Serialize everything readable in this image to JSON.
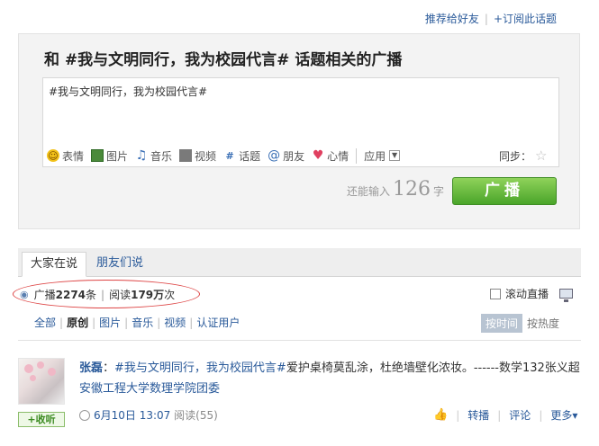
{
  "header": {
    "recommend_label": "推荐给好友",
    "subscribe_label": "+订阅此话题"
  },
  "composer": {
    "title": "和 #我与文明同行，我为校园代言# 话题相关的广播",
    "text": "#我与文明同行，我为校园代言#",
    "toolbar": {
      "emoji": "表情",
      "image": "图片",
      "music": "音乐",
      "video": "视频",
      "topic": "话题",
      "friends": "朋友",
      "mood": "心情",
      "apps": "应用"
    },
    "sync_label": "同步：",
    "remaining_prefix": "还能输入",
    "remaining_count": "126",
    "remaining_suffix": "字",
    "post_button": "广播"
  },
  "tabs": [
    {
      "label": "大家在说",
      "active": true
    },
    {
      "label": "朋友们说",
      "active": false
    }
  ],
  "stats": {
    "broadcast_label": "广播",
    "broadcast_count": "2274",
    "broadcast_unit": "条",
    "read_label": "阅读",
    "read_count": "179万",
    "read_unit": "次"
  },
  "live_label": "滚动直播",
  "filters": [
    "全部",
    "原创",
    "图片",
    "音乐",
    "视频",
    "认证用户"
  ],
  "selected_filter": "原创",
  "sort": {
    "by_time": "按时间",
    "by_hot": "按热度"
  },
  "post": {
    "author": "张磊",
    "colon": "：",
    "topic": "#我与文明同行，我为校园代言#",
    "text": "爱护桌椅莫乱涂，杜绝墙壁化浓妆。------数学132张义超",
    "org": "安徽工程大学数理学院团委",
    "time": "6月10日 13:07",
    "read_label": "阅读(55)",
    "follow_label": "收听",
    "repost": "转播",
    "comment": "评论",
    "more": "更多"
  },
  "colors": {
    "link": "#2a5a9a",
    "post_button": "#4aa52a",
    "annotation": "#dd4444"
  }
}
